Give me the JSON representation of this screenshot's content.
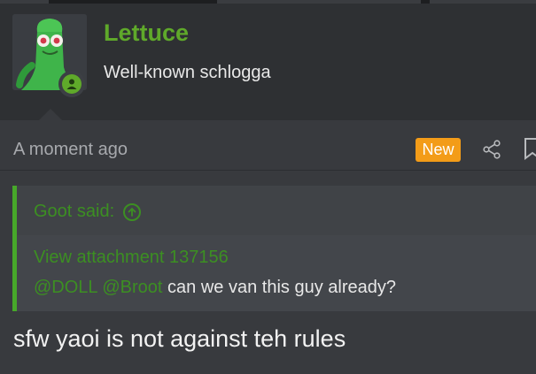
{
  "user": {
    "name": "Lettuce",
    "title": "Well-known schlogga",
    "avatar_icon": "clay-figure-avatar",
    "status_icon": "online-user-icon"
  },
  "post": {
    "timestamp": "A moment ago",
    "new_badge": "New",
    "actions": [
      "share-icon",
      "bookmark-icon"
    ],
    "quote": {
      "author_label": "Goot said:",
      "attachment_link": "View attachment 137156",
      "mentions": [
        "@DOLL",
        "@Broot"
      ],
      "text": "can we van this guy already?"
    },
    "body": "sfw yaoi is not against teh rules"
  },
  "colors": {
    "accent_green": "#5fa92a",
    "quote_green": "#3c8f22",
    "new_badge": "#f39c18",
    "background": "#2e3033",
    "message_bg": "#383a3e"
  }
}
